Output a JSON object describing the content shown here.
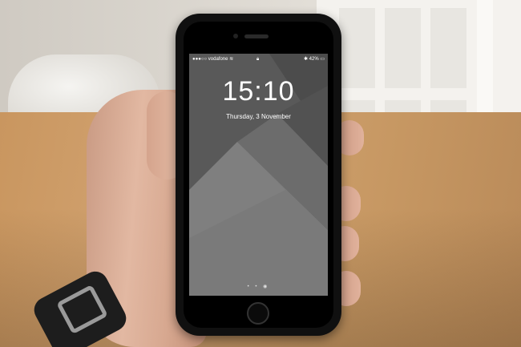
{
  "phone": {
    "carrier": "vodafone",
    "carrier_signal": "●●●○○",
    "wifi_icon": "wifi-icon",
    "lock_icon": "lock-icon",
    "battery_percent": "42%",
    "time": "15:10",
    "date": "Thursday, 3 November",
    "page_dots": "• • ◉"
  }
}
